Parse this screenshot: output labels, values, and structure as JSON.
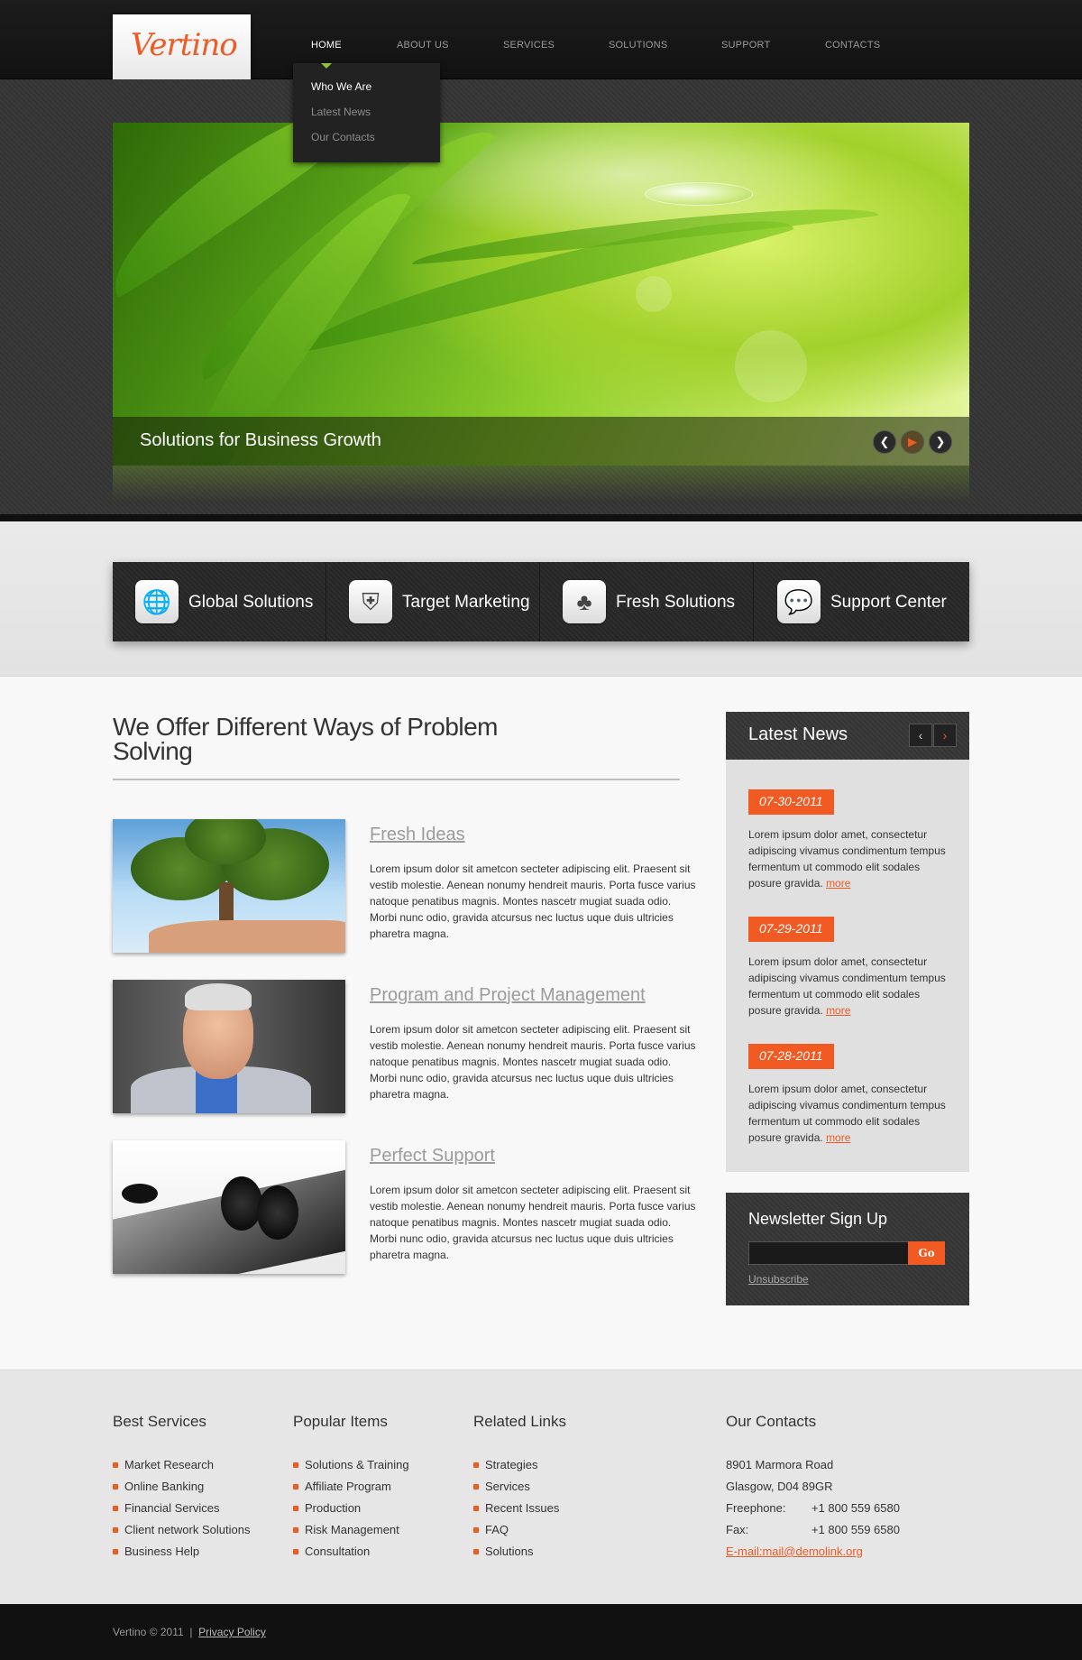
{
  "brand": {
    "logo_text": "Vertino",
    "accent_color": "#f15a22",
    "highlight_color": "#8bc33b"
  },
  "nav": {
    "items": [
      "HOME",
      "ABOUT US",
      "SERVICES",
      "SOLUTIONS",
      "SUPPORT",
      "CONTACTS"
    ],
    "active": "HOME",
    "dropdown": [
      "Who We Are",
      "Latest News",
      "Our Contacts"
    ]
  },
  "slider": {
    "caption": "Solutions for Business Growth",
    "prev_icon": "chevron-left-icon",
    "pause_icon": "play-icon",
    "next_icon": "chevron-right-icon"
  },
  "features": [
    {
      "label": "Global Solutions",
      "icon": "globe-icon"
    },
    {
      "label": "Target Marketing",
      "icon": "shield-icon"
    },
    {
      "label": "Fresh Solutions",
      "icon": "clover-icon"
    },
    {
      "label": "Support Center",
      "icon": "chat-bubble-icon"
    }
  ],
  "main": {
    "title": "We Offer Different Ways of Problem Solving",
    "services": [
      {
        "title": "Fresh Ideas",
        "text": "Lorem ipsum dolor sit ametcon secteter adipiscing elit. Praesent sit vestib molestie. Aenean nonumy hendreit mauris. Porta fusce varius natoque penatibus magnis. Montes nascetr mugiat suada odio. Morbi nunc odio, gravida atcursus nec luctus  uque duis ultricies pharetra magna."
      },
      {
        "title": "Program and Project Management",
        "text": "Lorem ipsum dolor sit ametcon secteter adipiscing elit. Praesent sit vestib molestie. Aenean nonumy hendreit mauris. Porta fusce varius natoque penatibus magnis. Montes nascetr mugiat suada odio. Morbi nunc odio, gravida atcursus nec luctus  uque duis ultricies pharetra magna."
      },
      {
        "title": "Perfect Support",
        "text": "Lorem ipsum dolor sit ametcon secteter adipiscing elit. Praesent sit vestib molestie. Aenean nonumy hendreit mauris. Porta fusce varius natoque penatibus magnis. Montes nascetr mugiat suada odio. Morbi nunc odio, gravida atcursus nec luctus  uque duis ultricies pharetra magna."
      }
    ]
  },
  "news": {
    "title": "Latest News",
    "items": [
      {
        "date": "07-30-2011",
        "text": "Lorem ipsum dolor amet, consectetur adipiscing vivamus condimentum tempus fermentum ut commodo elit sodales posure gravida.",
        "more": "more"
      },
      {
        "date": "07-29-2011",
        "text": "Lorem ipsum dolor amet, consectetur adipiscing vivamus condimentum tempus fermentum ut commodo elit sodales posure gravida.",
        "more": "more"
      },
      {
        "date": "07-28-2011",
        "text": "Lorem ipsum dolor amet, consectetur adipiscing vivamus condimentum tempus fermentum ut commodo elit sodales posure gravida.",
        "more": "more"
      }
    ]
  },
  "newsletter": {
    "title": "Newsletter Sign Up",
    "input_value": "",
    "go_label": "Go",
    "unsubscribe": "Unsubscribe"
  },
  "footer": {
    "best_services": {
      "title": "Best Services",
      "items": [
        "Market Research",
        "Online Banking",
        "Financial Services",
        "Client network Solutions",
        "Business Help"
      ]
    },
    "popular_items": {
      "title": "Popular Items",
      "items": [
        "Solutions & Training",
        "Affiliate Program",
        "Production",
        "Risk Management",
        "Consultation"
      ]
    },
    "related_links": {
      "title": "Related Links",
      "items": [
        "Strategies",
        "Services",
        "Recent Issues",
        "FAQ",
        "Solutions"
      ]
    },
    "contacts": {
      "title": "Our Contacts",
      "address1": "8901 Marmora Road",
      "address2": "Glasgow, D04 89GR",
      "freephone_label": "Freephone:",
      "freephone": "+1 800 559 6580",
      "fax_label": "Fax:",
      "fax": "+1 800 559 6580",
      "email": "E-mail:mail@demolink.org"
    },
    "copyright": "Vertino © 2011  |  ",
    "privacy": "Privacy Policy"
  }
}
